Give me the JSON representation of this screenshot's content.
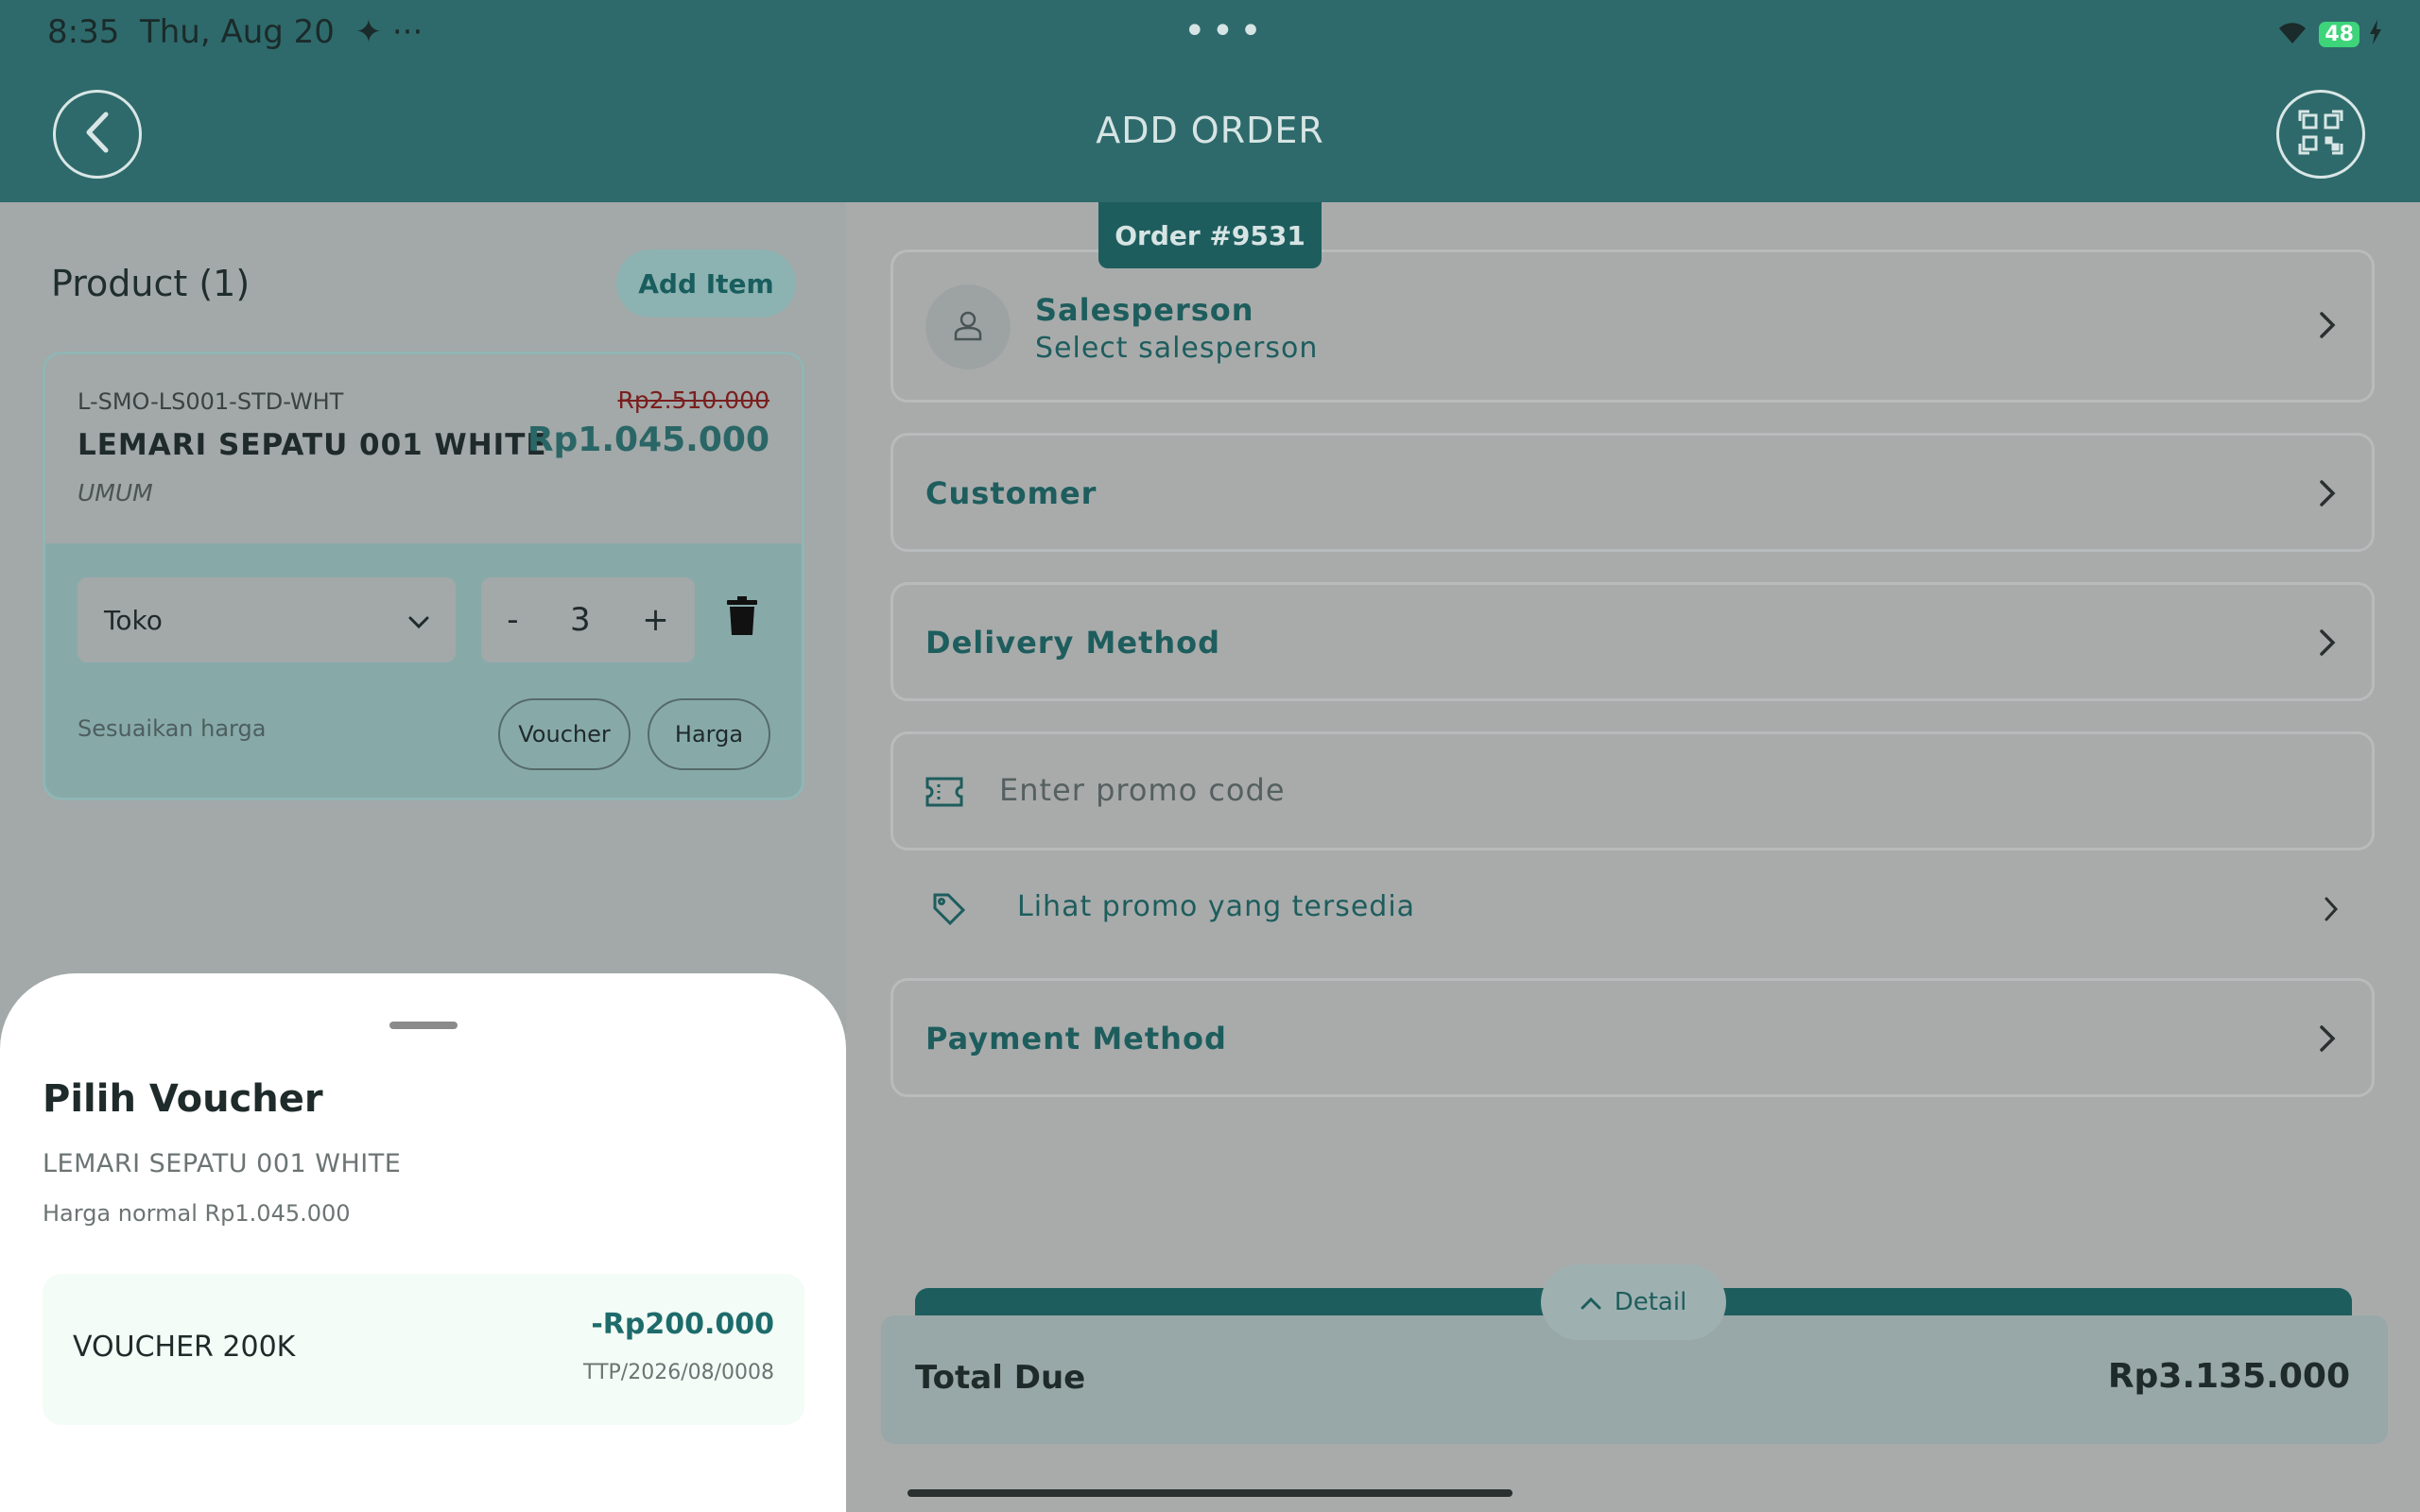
{
  "status_bar": {
    "time": "8:35",
    "date": "Thu, Aug 20",
    "extras": "✦ ···",
    "center_dots": "•••",
    "battery": "48"
  },
  "header": {
    "title": "ADD ORDER",
    "back_icon": "chevron-left-icon",
    "scan_icon": "qr-scan-icon"
  },
  "product_panel": {
    "title": "Product (1)",
    "add_item_label": "Add Item",
    "item": {
      "sku": "L-SMO-LS001-STD-WHT",
      "name": "LEMARI SEPATU 001 WHITE",
      "category": "UMUM",
      "price_original": "Rp2.510.000",
      "price_current": "Rp1.045.000",
      "location": "Toko",
      "qty_minus": "-",
      "quantity": "3",
      "qty_plus": "+",
      "adjust_label": "Sesuaikan harga",
      "voucher_label": "Voucher",
      "price_label": "Harga"
    }
  },
  "order": {
    "tag": "Order #9531",
    "salesperson_title": "Salesperson",
    "salesperson_placeholder": "Select salesperson",
    "customer_label": "Customer",
    "delivery_label": "Delivery Method",
    "promo_placeholder": "Enter promo code",
    "promo_link": "Lihat promo yang tersedia",
    "payment_label": "Payment Method",
    "detail_label": "Detail",
    "total_label": "Total Due",
    "total_value": "Rp3.135.000"
  },
  "voucher_sheet": {
    "title": "Pilih Voucher",
    "product": "LEMARI SEPATU 001 WHITE",
    "normal_price": "Harga normal Rp1.045.000",
    "vouchers": [
      {
        "name": "VOUCHER 200K",
        "amount": "-Rp200.000",
        "code": "TTP/2026/08/0008"
      }
    ]
  },
  "colors": {
    "header": "#2e6a6b",
    "accent": "#1e5d5d",
    "overlay_left": "#a3a8a8",
    "overlay_right": "#a9abab",
    "voucher_bg": "#f3fcf6"
  }
}
